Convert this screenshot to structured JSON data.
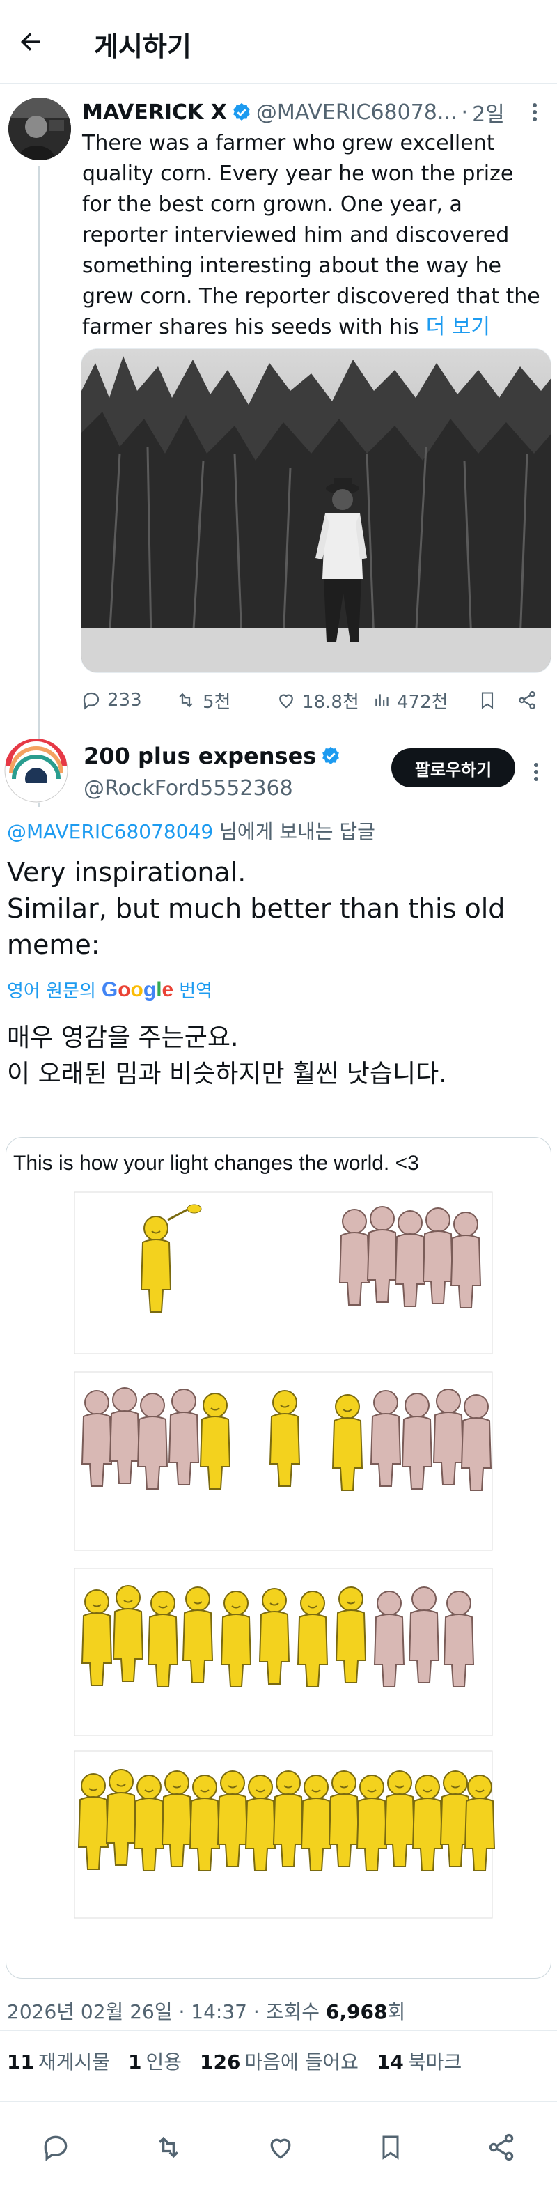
{
  "header": {
    "title": "게시하기"
  },
  "parent_post": {
    "name": "MAVERICK X",
    "handle": "@MAVERIC68078...",
    "dot": "·",
    "time": "2일",
    "text": "There was a farmer who grew excellent quality corn. Every year he won the prize for the best corn grown. One year, a reporter interviewed him and discovered something interesting about the way he grew corn. The reporter discovered that the farmer shares his seeds with his",
    "more_label": "더 보기",
    "stats": {
      "replies": "233",
      "reposts": "5천",
      "likes": "18.8천",
      "views": "472천"
    }
  },
  "reply": {
    "name": "200 plus expenses",
    "handle": "@RockFord5552368",
    "follow_label": "팔로우하기",
    "reply_to_handle": "@MAVERIC68078049",
    "reply_to_suffix": " 님에게 보내는 답글",
    "text": "Very inspirational.\nSimilar, but much better than this old meme:",
    "translate_prefix": "영어 원문의",
    "translate_brand": "Google",
    "translate_suffix": "번역",
    "translated_text": "매우 영감을 주는군요.\n이 오래된 밈과 비슷하지만 훨씬 낫습니다.",
    "meme_caption": "This is how your light changes the world. <3",
    "timestamp": "2026년 02월 26일 · 14:37 · 조회수 ",
    "views_count": "6,968",
    "views_suffix": "회",
    "stats": [
      {
        "count": "11",
        "label": "재게시물"
      },
      {
        "count": "1",
        "label": "인용"
      },
      {
        "count": "126",
        "label": "마음에 들어요"
      },
      {
        "count": "14",
        "label": "북마크"
      }
    ]
  },
  "colors": {
    "accent": "#1d9bf0",
    "text": "#0f1419",
    "muted": "#536471",
    "meme_yellow": "#f3d21e",
    "meme_pink": "#d8b8b4"
  }
}
